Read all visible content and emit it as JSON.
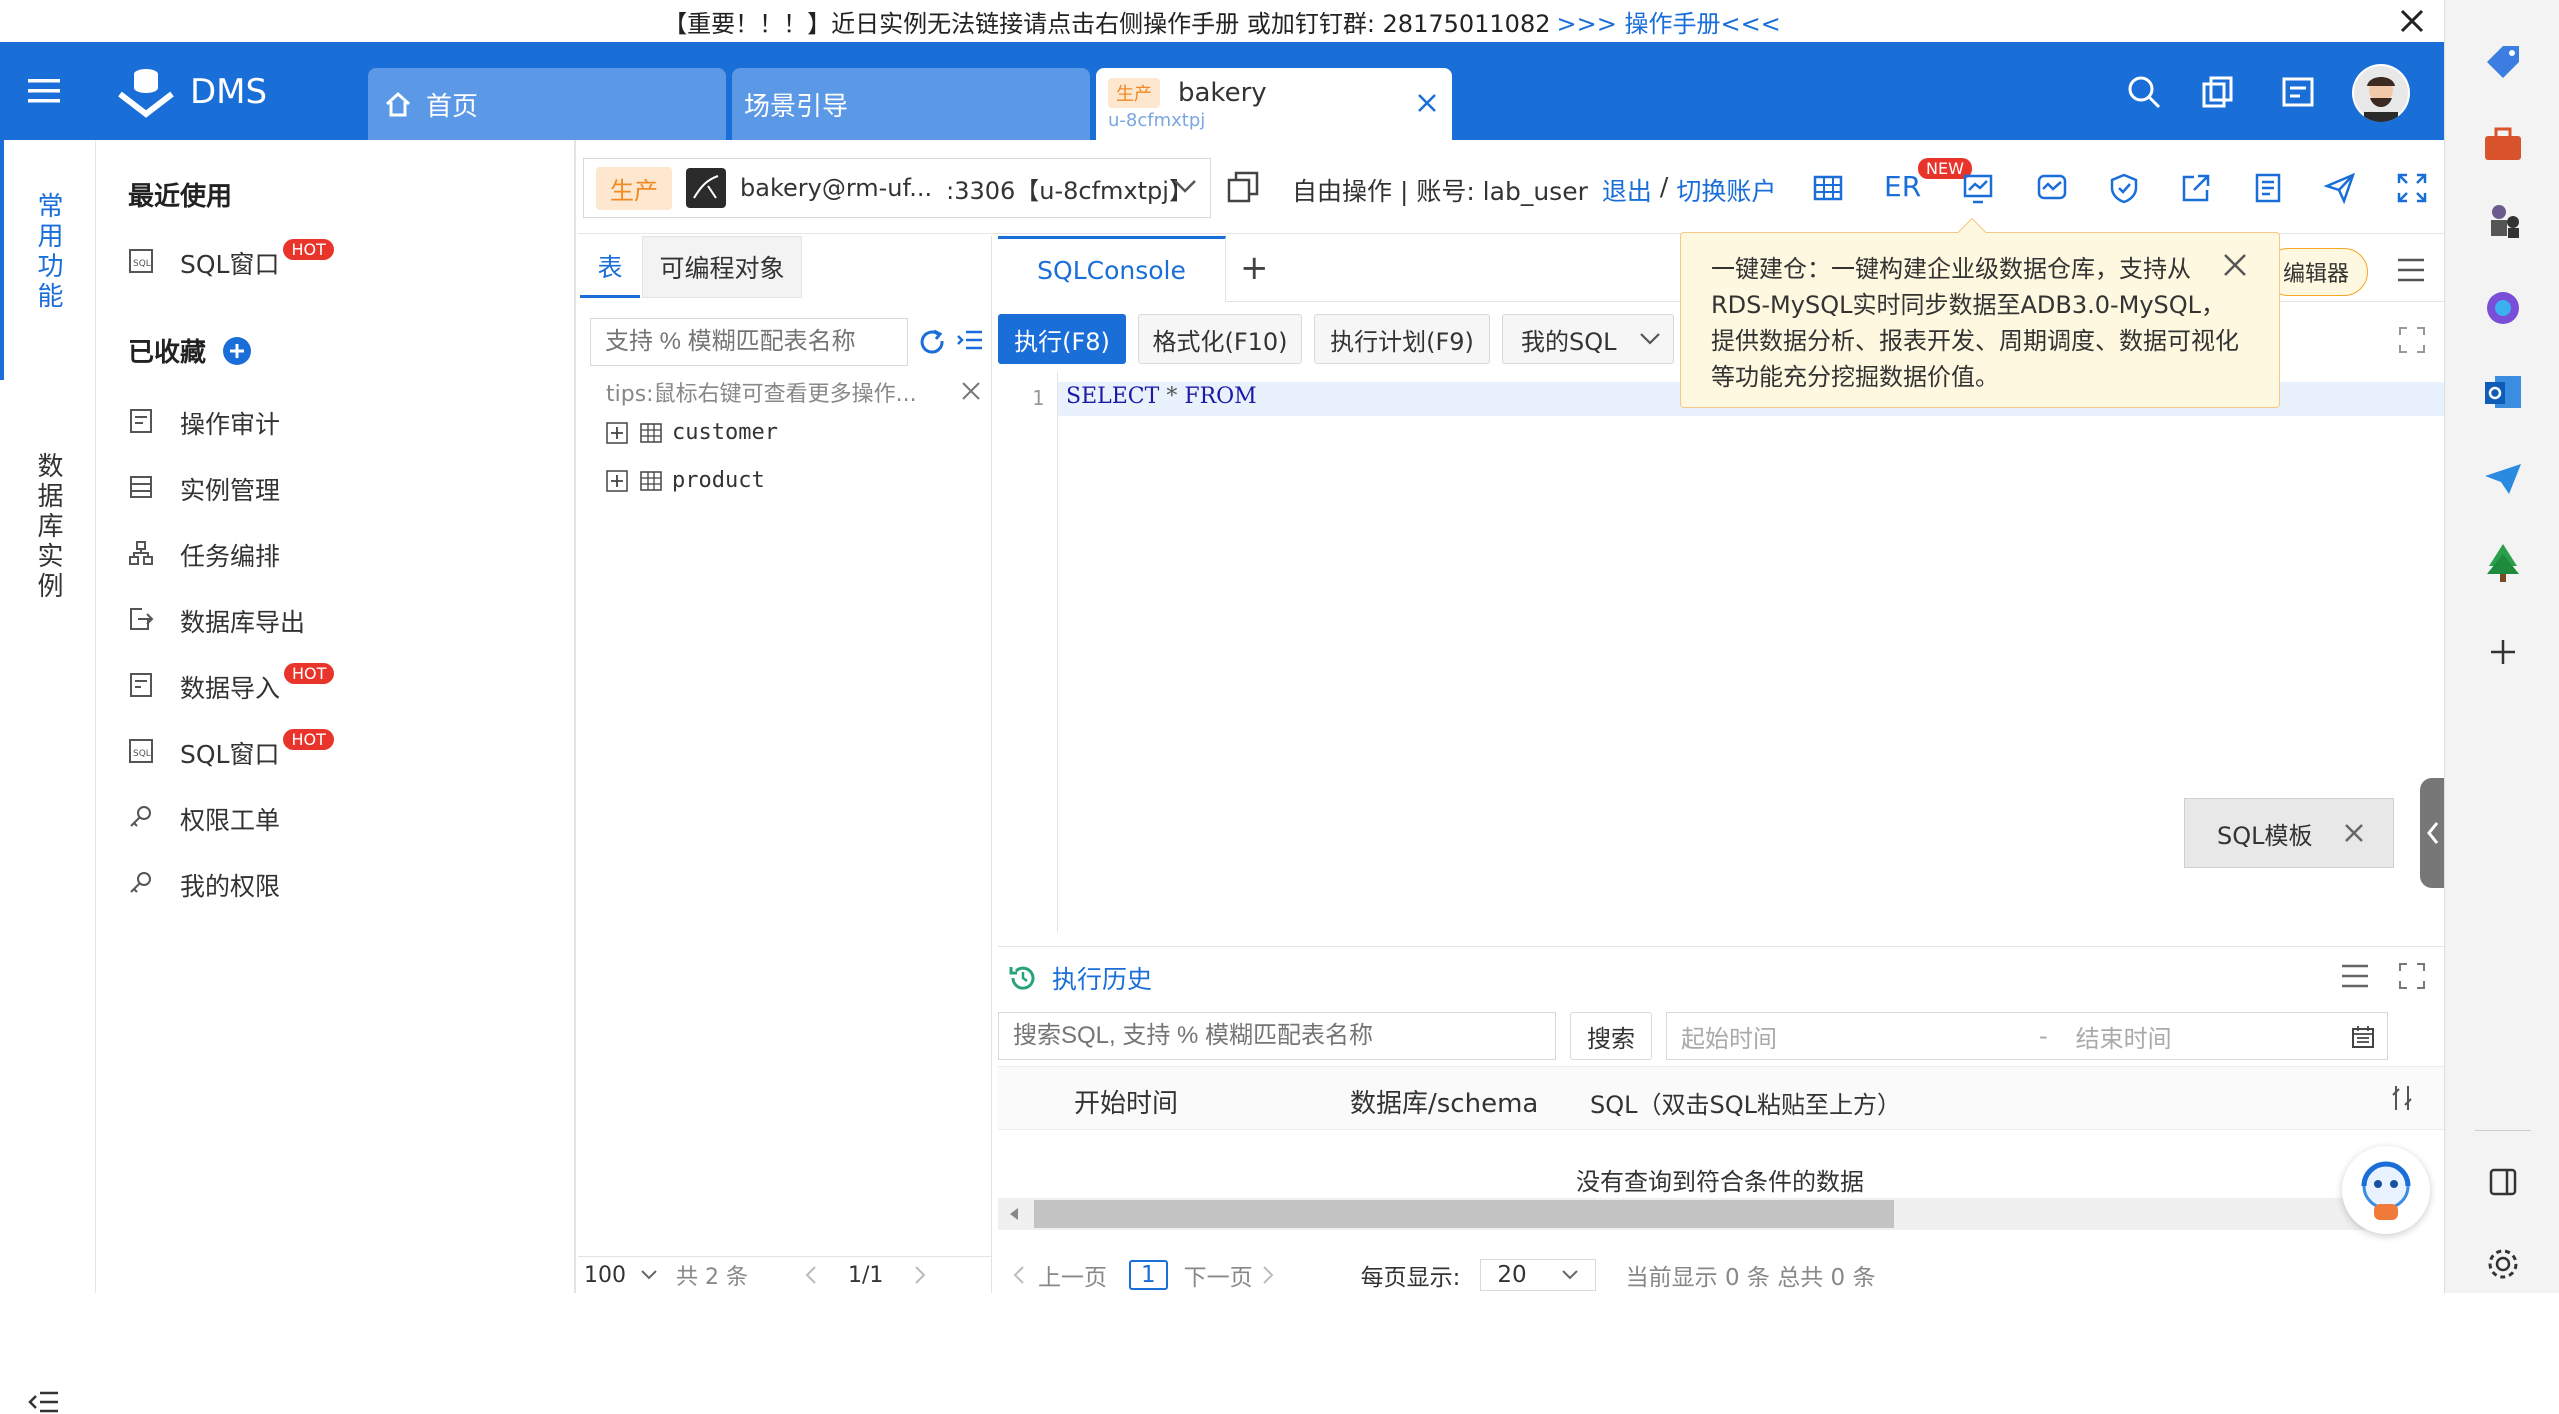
{
  "notice": {
    "text": "【重要！！！】近日实例无法链接请点击右侧操作手册 或加钉钉群: 28175011082",
    "link": ">>> 操作手册<<<"
  },
  "header": {
    "app_name": "DMS",
    "tabs": [
      {
        "label": "首页",
        "icon": "home-icon"
      },
      {
        "label": "场景引导"
      },
      {
        "label": "bakery",
        "env_tag": "生产",
        "sub": "u-8cfmxtpj"
      }
    ]
  },
  "left_strip": {
    "items": [
      "常用功能",
      "数据库实例"
    ]
  },
  "left_menu": {
    "recent_title": "最近使用",
    "recent": [
      {
        "label": "SQL窗口",
        "badge": "HOT"
      }
    ],
    "favorites_title": "已收藏",
    "favorites": [
      {
        "label": "操作审计"
      },
      {
        "label": "实例管理"
      },
      {
        "label": "任务编排"
      },
      {
        "label": "数据库导出"
      },
      {
        "label": "数据导入",
        "badge": "HOT"
      },
      {
        "label": "SQL窗口",
        "badge": "HOT"
      },
      {
        "label": "权限工单"
      },
      {
        "label": "我的权限"
      }
    ]
  },
  "conn": {
    "env_tag": "生产",
    "db": "bakery@rm-uf...",
    "port": ":3306【u-8cfmxtpj】",
    "mode": "自由操作 | 账号: lab_user",
    "logout": "退出",
    "sep": "/",
    "switch": "切换账户",
    "er_label": "ER",
    "new_badge": "NEW"
  },
  "tree": {
    "tabs": [
      "表",
      "可编程对象"
    ],
    "search_placeholder": "支持 % 模糊匹配表名称",
    "tips": "tips:鼠标右键可查看更多操作...",
    "tables": [
      "customer",
      "product"
    ],
    "page_size": "100",
    "total": "共 2 条",
    "page": "1/1"
  },
  "editor": {
    "tab": "SQLConsole",
    "add": "+",
    "buttons": [
      "执行(F8)",
      "格式化(F10)",
      "执行计划(F9)",
      "我的SQL"
    ],
    "line_no": "1",
    "sql_kw1": "SELECT",
    "sql_star": "*",
    "sql_kw2": "FROM",
    "editor_btn": "编辑器",
    "template_label": "SQL模板"
  },
  "tooltip": {
    "text": "一键建仓：一键构建企业级数据仓库，支持从RDS-MySQL实时同步数据至ADB3.0-MySQL，提供数据分析、报表开发、周期调度、数据可视化等功能充分挖掘数据价值。"
  },
  "history": {
    "title": "执行历史",
    "search_placeholder": "搜索SQL, 支持 % 模糊匹配表名称",
    "search_btn": "搜索",
    "start_placeholder": "起始时间",
    "dash": "-",
    "end_placeholder": "结束时间",
    "columns": [
      "开始时间",
      "数据库/schema",
      "SQL（双击SQL粘贴至上方）"
    ],
    "empty": "没有查询到符合条件的数据",
    "prev": "上一页",
    "page": "1",
    "next": "下一页",
    "per_page_label": "每页显示:",
    "per_page": "20",
    "summary": "当前显示 0 条 总共 0 条"
  },
  "colors": {
    "primary": "#1a6ed8",
    "prod": "#f08a24",
    "hot": "#e8342a"
  }
}
